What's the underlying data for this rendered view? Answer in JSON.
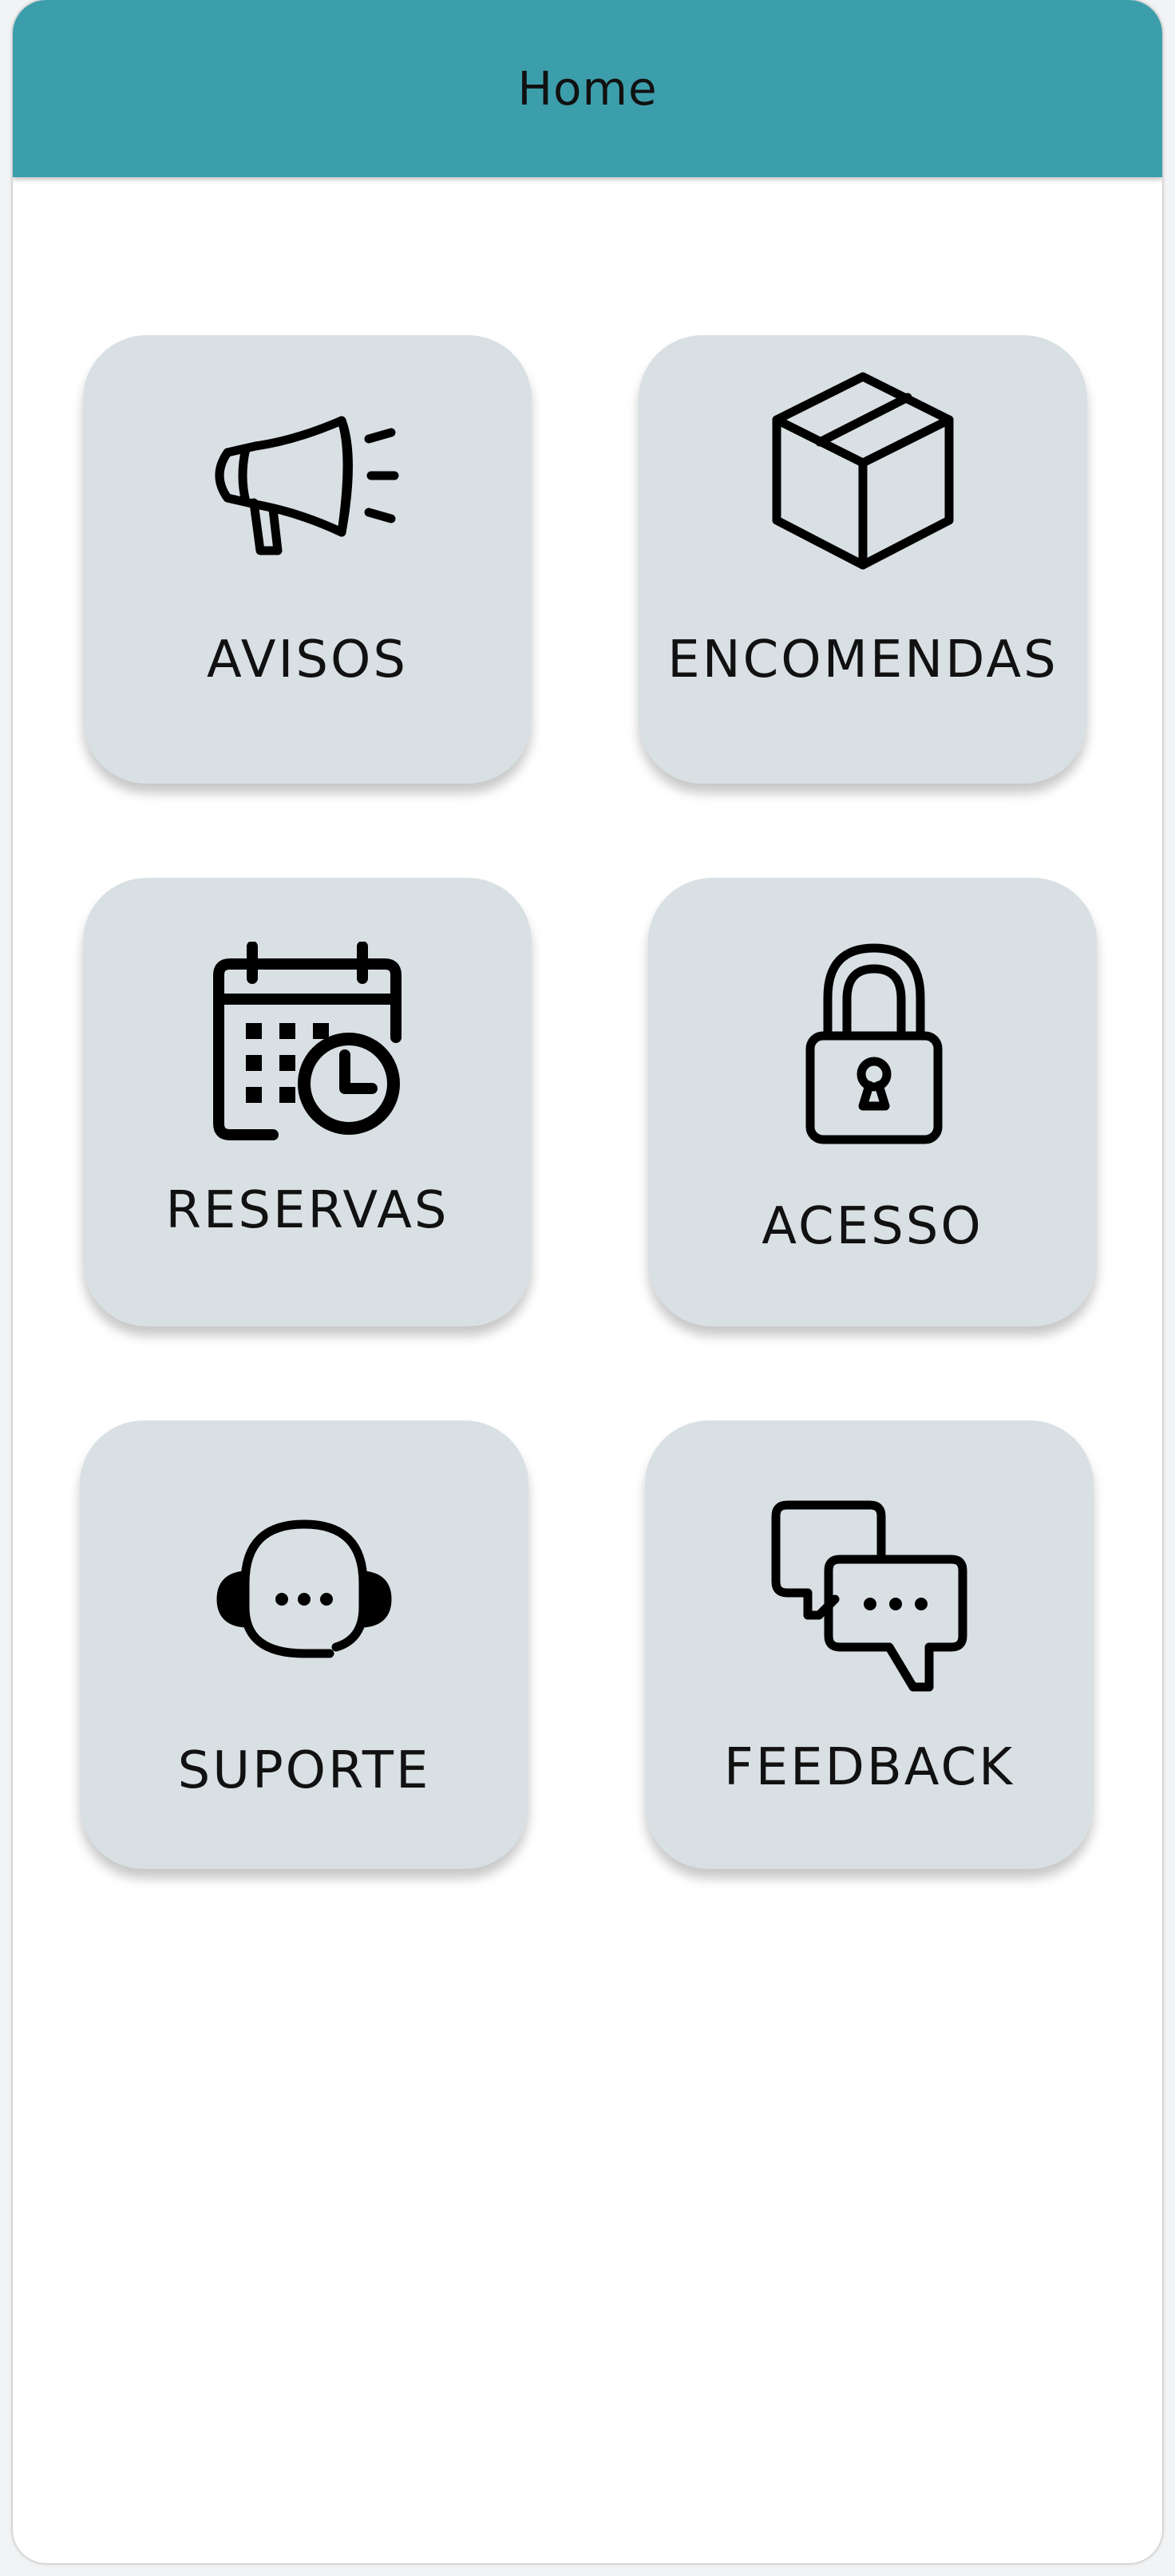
{
  "header": {
    "title": "Home"
  },
  "colors": {
    "header_background": "#3d9eab",
    "tile_background": "#d8e0e4",
    "page_background": "#ffffff"
  },
  "tiles": [
    {
      "label": "AVISOS",
      "icon": "megaphone-icon"
    },
    {
      "label": "ENCOMENDAS",
      "icon": "package-box-icon"
    },
    {
      "label": "RESERVAS",
      "icon": "calendar-clock-icon"
    },
    {
      "label": "ACESSO",
      "icon": "unlocked-padlock-icon"
    },
    {
      "label": "SUPORTE",
      "icon": "headset-support-icon"
    },
    {
      "label": "FEEDBACK",
      "icon": "chat-bubbles-icon"
    }
  ]
}
